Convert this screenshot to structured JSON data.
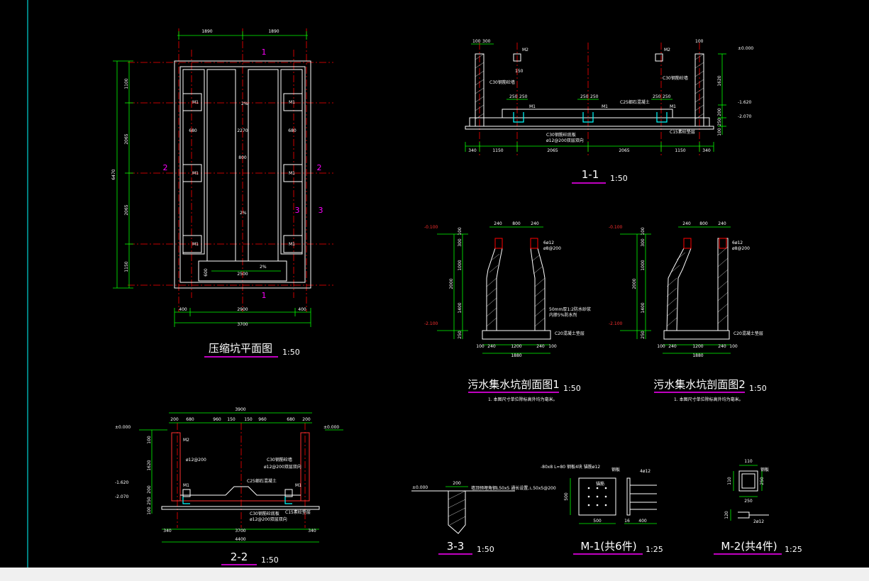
{
  "colors": {
    "background": "#000000",
    "outline": "#ffffff",
    "dimension": "#00ff00",
    "centerline": "#ff0000",
    "section_mark": "#ff00ff",
    "rebar": "#00ffff"
  },
  "views": {
    "plan": {
      "title": "压缩坑平面图",
      "scale": "1:50",
      "section_marks": [
        "1",
        "1",
        "2",
        "2",
        "3",
        "3"
      ],
      "dims_top": [
        "1890",
        "1890"
      ],
      "dims_bottom": [
        "400",
        "2900",
        "400"
      ],
      "dim_total": "3700",
      "dims_left": [
        "1100",
        "2065",
        "2065",
        "1150"
      ],
      "dim_left_total": "6470",
      "inner_dims": [
        "680",
        "2270",
        "680",
        "800",
        "600",
        "2500"
      ],
      "slopes": [
        "2%",
        "2%",
        "2%"
      ],
      "embed_labels": [
        "M1",
        "M1",
        "M1",
        "M1",
        "M1",
        "M1"
      ]
    },
    "section11": {
      "title": "1-1",
      "scale": "1:50",
      "dims_top": [
        "100",
        "300",
        "100"
      ],
      "dims_bottom": [
        "340",
        "1150",
        "2065",
        "2065",
        "1150",
        "340"
      ],
      "inner_dims": [
        "250",
        "250",
        "250",
        "250",
        "250",
        "250",
        "150"
      ],
      "elevations": [
        "±0.000",
        "-1.620",
        "-2.070"
      ],
      "dims_right": [
        "1620",
        "200",
        "250",
        "100"
      ],
      "labels": [
        "M2",
        "M2",
        "C30钢筋砼墙",
        "C30钢筋砼墙",
        "C25细石混凝土",
        "M1",
        "M1",
        "M1",
        "C30钢筋砼底板",
        "ø12@200双层双向",
        "C15素砼垫层"
      ]
    },
    "sump1": {
      "title": "污水集水坑剖面图1",
      "scale": "1:50",
      "note": "1. 本图尺寸单位除标高外均为毫米。",
      "elevation_top": "-0.100",
      "elevation_bottom": "-2.100",
      "dims_top": [
        "240",
        "800",
        "240"
      ],
      "dims_bottom": [
        "100",
        "240",
        "1200",
        "240",
        "100"
      ],
      "dim_total": "1880",
      "dims_left": [
        "100",
        "300",
        "1000",
        "2000",
        "1400",
        "250"
      ],
      "labels": [
        "6ø12",
        "ø8@200",
        "50mm厚1:2防水砂浆",
        "内掺5%防水剂",
        "C20混凝土垫层"
      ]
    },
    "sump2": {
      "title": "污水集水坑剖面图2",
      "scale": "1:50",
      "note": "1. 本图尺寸单位除标高外均为毫米。",
      "elevation_top": "-0.100",
      "elevation_bottom": "-2.100",
      "dims_top": [
        "240",
        "800",
        "240"
      ],
      "dims_bottom": [
        "100",
        "240",
        "1200",
        "240",
        "100"
      ],
      "dim_total": "1880",
      "dims_left": [
        "100",
        "300",
        "1000",
        "2000",
        "1400",
        "250"
      ],
      "labels": [
        "6ø12",
        "ø8@200",
        "C20混凝土垫层"
      ]
    },
    "section22": {
      "title": "2-2",
      "scale": "1:50",
      "dim_top_total": "3900",
      "dims_top": [
        "200",
        "680",
        "960",
        "150",
        "150",
        "960",
        "680",
        "200"
      ],
      "dims_bottom": [
        "340",
        "3700",
        "340"
      ],
      "dim_total": "4400",
      "elevations": [
        "±0.000",
        "±0.000",
        "-1.620",
        "-2.070"
      ],
      "dims_left": [
        "100",
        "1620",
        "200",
        "250",
        "100"
      ],
      "labels": [
        "M2",
        "ø12@200",
        "C30钢筋砼墙",
        "ø12@200双层双向",
        "C25细石混凝土",
        "M1",
        "M1",
        "C30钢筋砼底板",
        "ø12@200双层双向",
        "C15素砼垫层"
      ]
    },
    "section33": {
      "title": "3-3",
      "scale": "1:50",
      "elevation": "±0.000",
      "dim": "200",
      "note": "墙顶预埋角钢L50x5 通长设置,∟50x5@200"
    },
    "m1": {
      "title": "M-1(共6件)",
      "scale": "1:25",
      "note": "-80x8 L=80 钢板4块 锚筋ø12",
      "dims": [
        "500",
        "500",
        "16",
        "400"
      ],
      "labels": [
        "4ø12",
        "锚筋",
        "钢板"
      ]
    },
    "m2": {
      "title": "M-2(共4件)",
      "scale": "1:25",
      "dims": [
        "110",
        "250",
        "250",
        "110",
        "120"
      ],
      "labels": [
        "2ø12",
        "钢板"
      ]
    }
  }
}
